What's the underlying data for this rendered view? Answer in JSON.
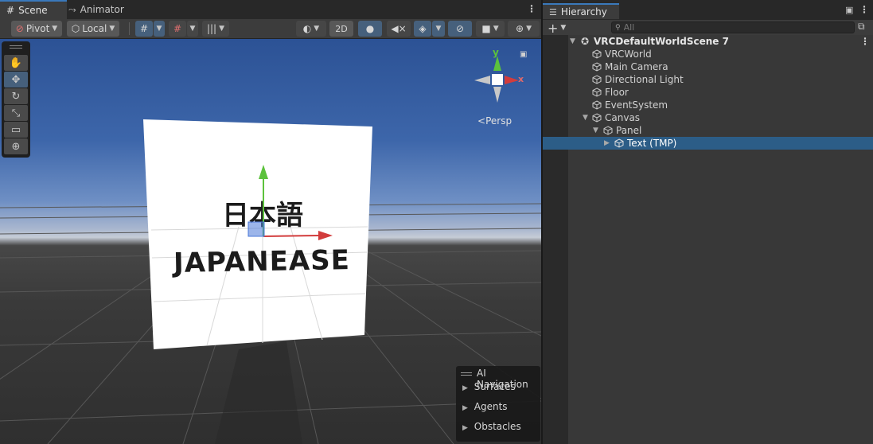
{
  "scene": {
    "tabs": [
      {
        "label": "Scene",
        "icon": "grid-icon"
      },
      {
        "label": "Animator",
        "icon": "animator-icon"
      }
    ],
    "toolbar": {
      "pivot_label": "Pivot",
      "local_label": "Local",
      "mode_2d_label": "2D"
    },
    "gizmo": {
      "y_label": "y",
      "x_label": "x",
      "persp_label": "Persp"
    },
    "quad_text": {
      "line1": "日本語",
      "line2": "JAPANEASE"
    },
    "ai_navigation": {
      "title": "AI Navigation",
      "items": [
        "Surfaces",
        "Agents",
        "Obstacles"
      ]
    }
  },
  "hierarchy": {
    "tab_label": "Hierarchy",
    "search_placeholder": "All",
    "nodes": [
      {
        "label": "VRCDefaultWorldScene 7",
        "depth": 0,
        "expanded": true,
        "scene_root": true
      },
      {
        "label": "VRCWorld",
        "depth": 1
      },
      {
        "label": "Main Camera",
        "depth": 1
      },
      {
        "label": "Directional Light",
        "depth": 1
      },
      {
        "label": "Floor",
        "depth": 1
      },
      {
        "label": "EventSystem",
        "depth": 1
      },
      {
        "label": "Canvas",
        "depth": 1,
        "expanded": true
      },
      {
        "label": "Panel",
        "depth": 2,
        "expanded": true
      },
      {
        "label": "Text (TMP)",
        "depth": 3,
        "collapsed": true,
        "selected": true
      }
    ]
  },
  "colors": {
    "accent": "#3a79bb",
    "selection": "#2c5d87",
    "axis_x": "#d23c3c",
    "axis_y": "#5cc23c",
    "axis_z": "#4a78d8"
  }
}
